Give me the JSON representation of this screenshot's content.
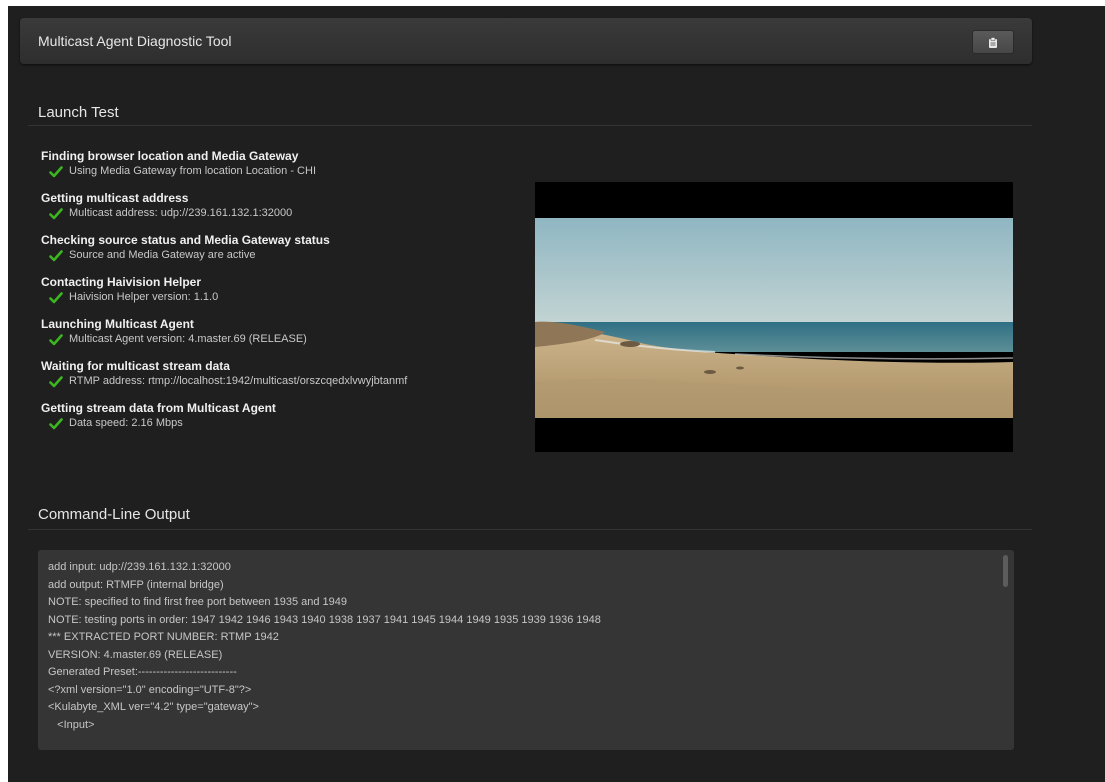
{
  "header": {
    "title": "Multicast Agent Diagnostic Tool"
  },
  "launch": {
    "section_title": "Launch Test",
    "steps": [
      {
        "title": "Finding browser location and Media Gateway",
        "result": "Using Media Gateway from location Location - CHI"
      },
      {
        "title": "Getting multicast address",
        "result": "Multicast address: udp://239.161.132.1:32000"
      },
      {
        "title": "Checking source status and Media Gateway status",
        "result": "Source and Media Gateway are active"
      },
      {
        "title": "Contacting Haivision Helper",
        "result": "Haivision Helper version: 1.1.0"
      },
      {
        "title": "Launching Multicast Agent",
        "result": "Multicast Agent version: 4.master.69 (RELEASE)"
      },
      {
        "title": "Waiting for multicast stream data",
        "result": "RTMP address: rtmp://localhost:1942/multicast/orszcqedxlvwyjbtanmf"
      },
      {
        "title": "Getting stream data from Multicast Agent",
        "result": "Data speed: 2.16 Mbps"
      }
    ]
  },
  "console": {
    "section_title": "Command-Line Output",
    "lines": [
      "add input: udp://239.161.132.1:32000",
      "add output: RTMFP (internal bridge)",
      "NOTE: specified to find first free port between 1935 and 1949",
      "NOTE: testing ports in order: 1947 1942 1946 1943 1940 1938 1937 1941 1945 1944 1949 1935 1939 1936 1948",
      "*** EXTRACTED PORT NUMBER: RTMP 1942",
      "VERSION: 4.master.69 (RELEASE)",
      "Generated Preset:---------------------------",
      "<?xml version=\"1.0\" encoding=\"UTF-8\"?>",
      "<Kulabyte_XML ver=\"4.2\" type=\"gateway\">",
      "   <Input>"
    ]
  },
  "colors": {
    "check": "#3cb521",
    "background": "#1f1f1f",
    "console_bg": "#353535"
  }
}
